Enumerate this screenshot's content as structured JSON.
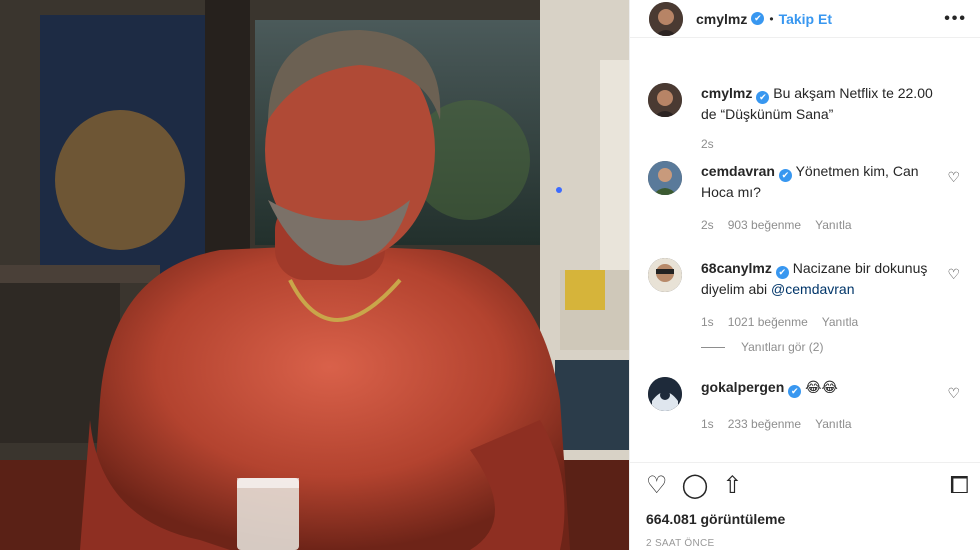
{
  "post": {
    "username": "cmylmz",
    "follow_label": "Takip Et",
    "more_label": "•••",
    "dot_separator": "•",
    "views": "664.081 görüntüleme",
    "time": "2 SAAT ÖNCE"
  },
  "caption": {
    "username": "cmylmz",
    "text": "Bu akşam Netflix te 22.00 de “Düşkünüm Sana”",
    "time": "2s"
  },
  "comments": [
    {
      "username": "cemdavran",
      "text": "Yönetmen kim, Can Hoca mı?",
      "time": "2s",
      "likes": "903 beğenme",
      "reply": "Yanıtla"
    },
    {
      "username": "68canylmz",
      "text_before": "Nacizane bir dokunuş diyelim abi ",
      "mention": "@cemdavran",
      "time": "1s",
      "likes": "1021 beğenme",
      "reply": "Yanıtla",
      "view_replies": "Yanıtları gör (2)"
    },
    {
      "username": "gokalpergen",
      "text": "😂😂",
      "time": "1s",
      "likes": "233 beğenme",
      "reply": "Yanıtla"
    }
  ],
  "icons": {
    "verified": "✔",
    "heart": "♡",
    "comment": "◯",
    "share": "⇧",
    "save": "⧠"
  }
}
